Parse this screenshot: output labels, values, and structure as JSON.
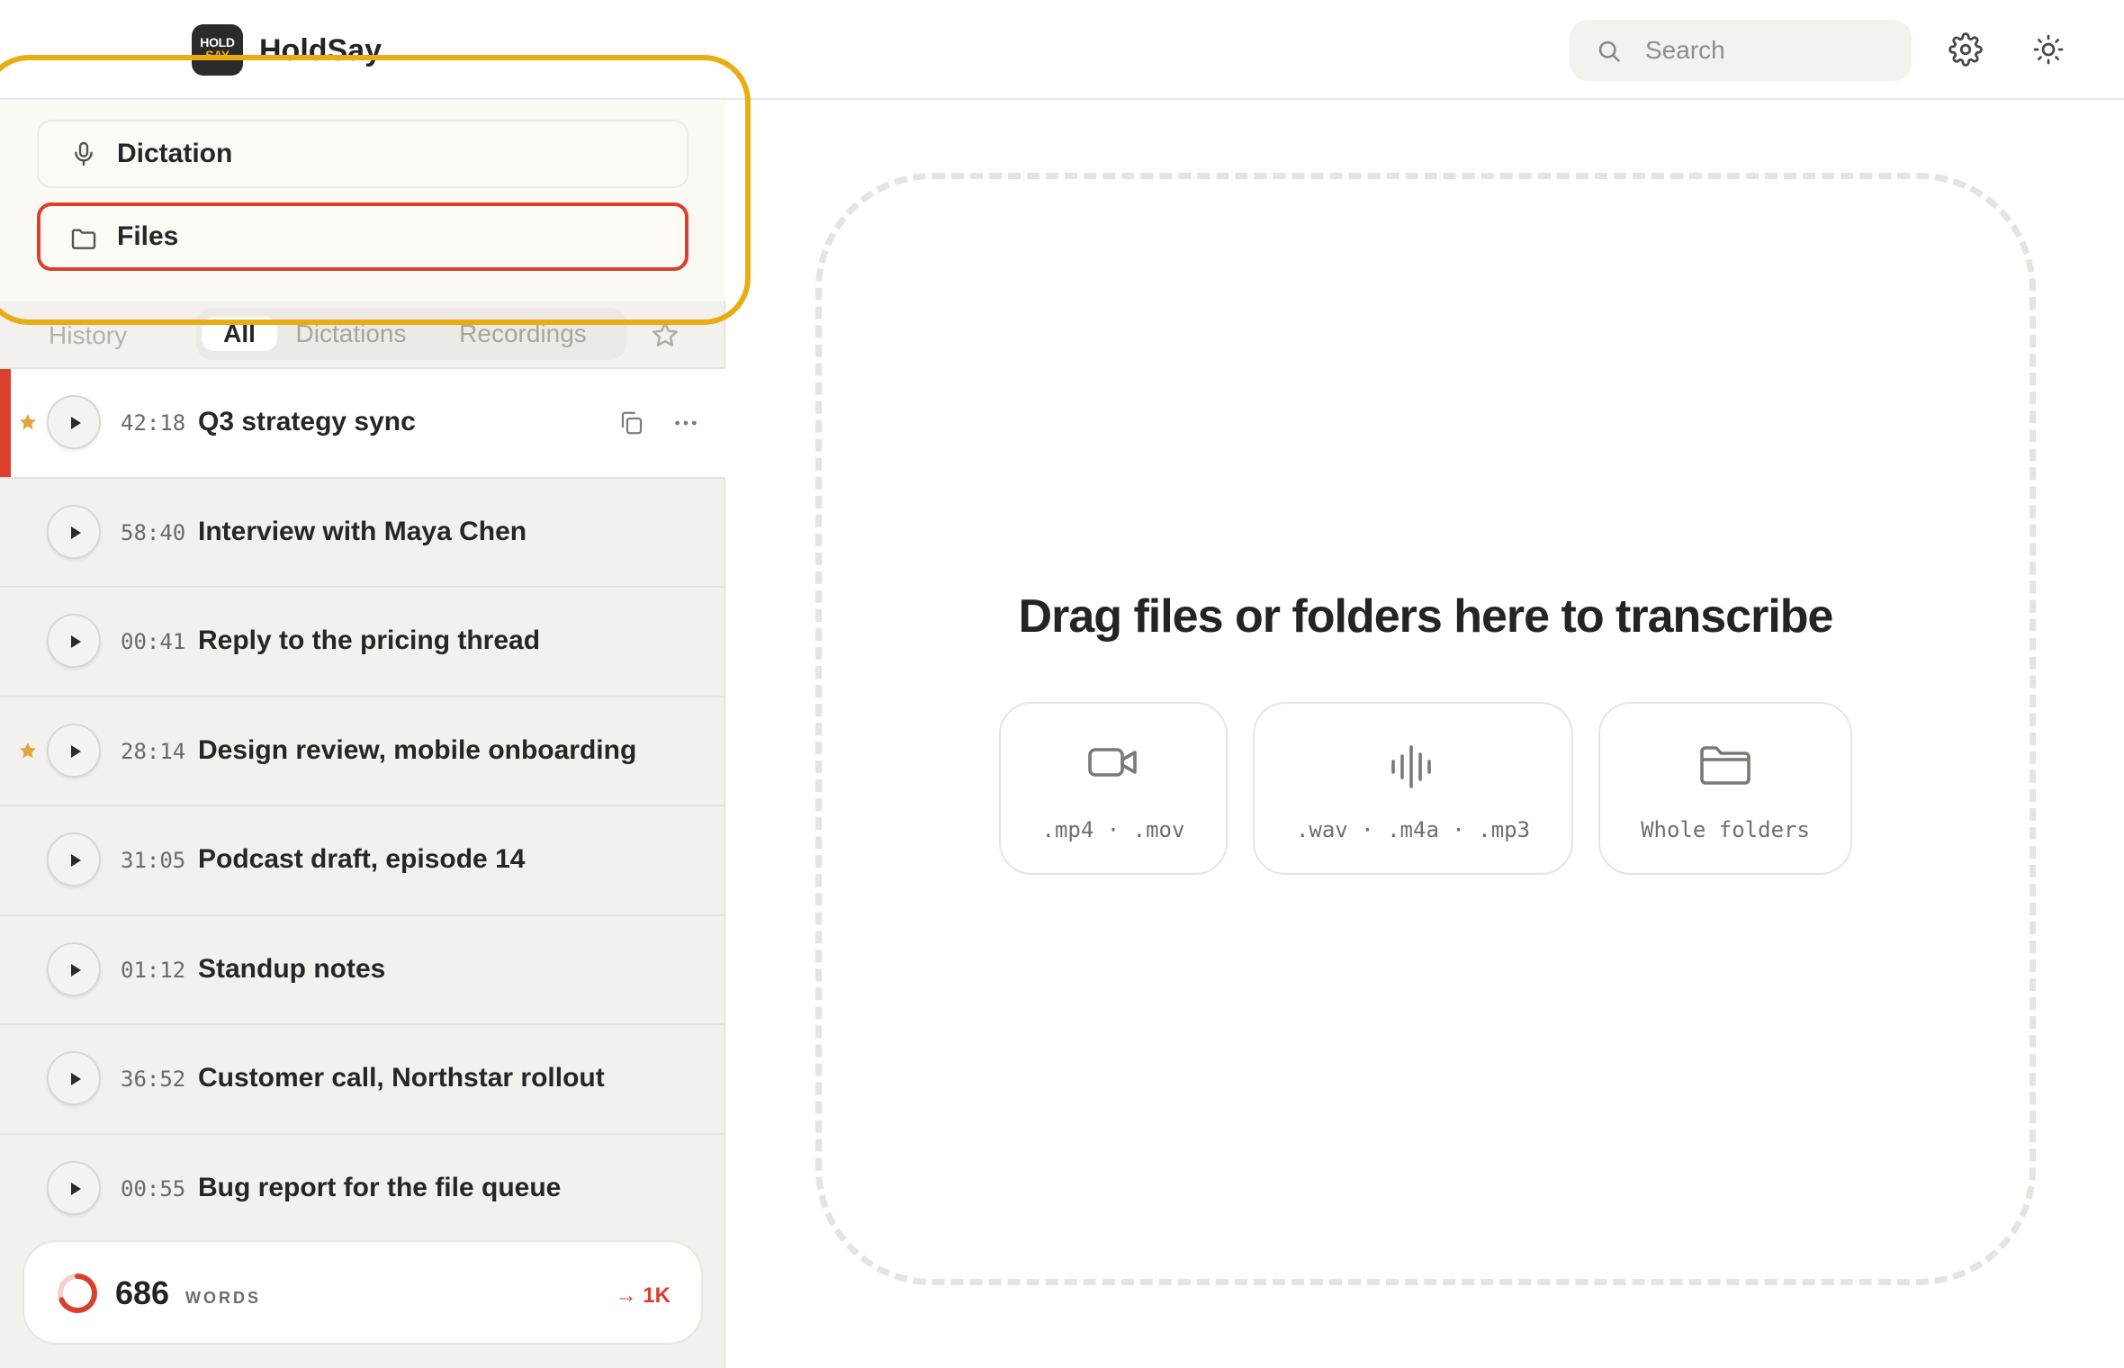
{
  "app": {
    "name": "HoldSay",
    "logo_line1": "HOLD",
    "logo_line2": "SAY"
  },
  "header": {
    "search_placeholder": "Search"
  },
  "modes": {
    "dictation_label": "Dictation",
    "files_label": "Files",
    "selected": "Files"
  },
  "history": {
    "label": "History",
    "tabs": [
      "All",
      "Dictations",
      "Recordings"
    ],
    "active_tab": "All"
  },
  "items": [
    {
      "duration": "42:18",
      "title": "Q3 strategy sync",
      "starred": true,
      "selected": true
    },
    {
      "duration": "58:40",
      "title": "Interview with Maya Chen",
      "starred": false,
      "selected": false
    },
    {
      "duration": "00:41",
      "title": "Reply to the pricing thread",
      "starred": false,
      "selected": false
    },
    {
      "duration": "28:14",
      "title": "Design review, mobile onboarding",
      "starred": true,
      "selected": false
    },
    {
      "duration": "31:05",
      "title": "Podcast draft, episode 14",
      "starred": false,
      "selected": false
    },
    {
      "duration": "01:12",
      "title": "Standup notes",
      "starred": false,
      "selected": false
    },
    {
      "duration": "36:52",
      "title": "Customer call, Northstar rollout",
      "starred": false,
      "selected": false
    },
    {
      "duration": "00:55",
      "title": "Bug report for the file queue",
      "starred": false,
      "selected": false
    }
  ],
  "stats": {
    "words": "686",
    "unit": "WORDS",
    "goal": "→ 1K",
    "progress": 0.686
  },
  "dropzone": {
    "title": "Drag files or folders here to transcribe",
    "chips": [
      {
        "icon": "video-icon",
        "label": ".mp4 · .mov"
      },
      {
        "icon": "waveform-icon",
        "label": ".wav · .m4a · .mp3"
      },
      {
        "icon": "folder-icon",
        "label": "Whole folders"
      }
    ]
  },
  "colors": {
    "accent": "#dc3f2b",
    "star": "#e2a53c",
    "focus_ring": "#e8ad12"
  }
}
